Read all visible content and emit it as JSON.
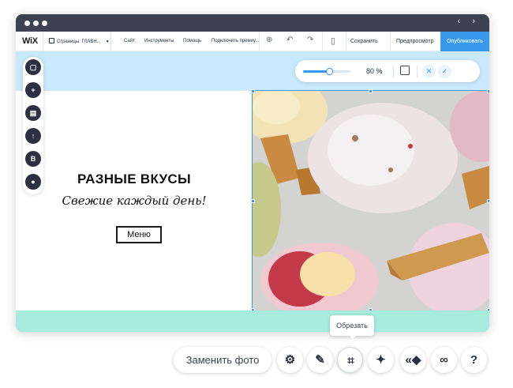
{
  "titlebar": {
    "arrows": "‹ ›"
  },
  "toolbar": {
    "logo": "WiX",
    "pages_label": "Страницы: ГЛАВН...",
    "menu": [
      "Сайт",
      "Инструменты",
      "Помощь",
      "Подключить премиу..."
    ],
    "save_label": "Сохранить",
    "preview_label": "Предпросмотр",
    "publish_label": "Опубликовать"
  },
  "zoom": {
    "value_label": "80 %",
    "fraction": 0.55
  },
  "hero": {
    "title": "РАЗНЫЕ ВКУСЫ",
    "subtitle": "Свежие каждый день!",
    "button_label": "Меню"
  },
  "left_rail": {
    "items": [
      "square-icon",
      "add-icon",
      "store-icon",
      "upload-icon",
      "blog-icon",
      "chat-icon"
    ],
    "blog_letter": "B"
  },
  "action_bar": {
    "replace_label": "Заменить фото",
    "tooltip": "Обрезать",
    "buttons": [
      "gear-icon",
      "brush-icon",
      "crop-icon",
      "magic-wand-icon",
      "animation-icon",
      "link-icon",
      "help-icon"
    ]
  },
  "colors": {
    "accent": "#3899ec",
    "canvas_bg": "#c9eafc",
    "footer_bar": "#a8ecdc",
    "titlebar": "#3d4250"
  }
}
